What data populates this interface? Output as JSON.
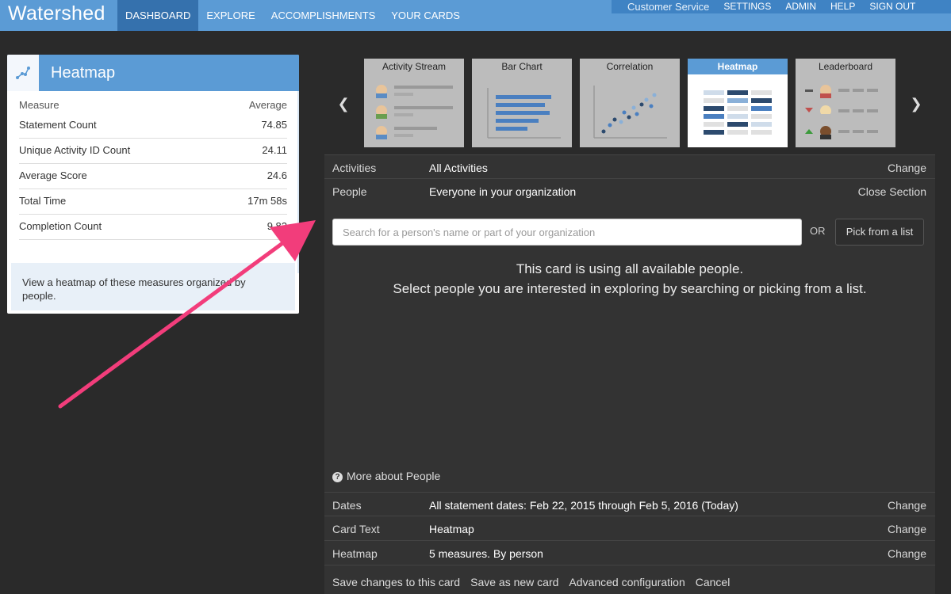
{
  "app": {
    "logo": "Watershed",
    "nav": [
      "DASHBOARD",
      "EXPLORE",
      "ACCOMPLISHMENTS",
      "YOUR CARDS"
    ],
    "utility": [
      "Customer Service",
      "SETTINGS",
      "ADMIN",
      "HELP",
      "SIGN OUT"
    ],
    "accent": "#5b9bd5"
  },
  "card": {
    "title": "Heatmap",
    "icon": "scatter-trend-icon",
    "header_measure": "Measure",
    "header_average": "Average",
    "rows": [
      {
        "label": "Statement Count",
        "value": "74.85"
      },
      {
        "label": "Unique Activity ID Count",
        "value": "24.11"
      },
      {
        "label": "Average Score",
        "value": "24.6"
      },
      {
        "label": "Total Time",
        "value": "17m 58s"
      },
      {
        "label": "Completion Count",
        "value": "9.82"
      }
    ],
    "description": "View a heatmap of these measures organized by people."
  },
  "editor": {
    "card_types": [
      "Activity Stream",
      "Bar Chart",
      "Correlation",
      "Heatmap",
      "Leaderboard"
    ],
    "selected_type": "Heatmap",
    "sections": {
      "activities": {
        "label": "Activities",
        "value": "All Activities",
        "action": "Change"
      },
      "people": {
        "label": "People",
        "value": "Everyone in your organization",
        "action": "Close Section"
      },
      "dates": {
        "label": "Dates",
        "value": "All statement dates: Feb 22, 2015 through Feb 5, 2016 (Today)",
        "action": "Change"
      },
      "card_text": {
        "label": "Card Text",
        "value": "Heatmap",
        "action": "Change"
      },
      "heatmap": {
        "label": "Heatmap",
        "value": "5 measures. By person",
        "action": "Change"
      }
    },
    "search_placeholder": "Search for a person's name or part of your organization",
    "or_label": "OR",
    "pick_button": "Pick from a list",
    "message_line1": "This card is using all available people.",
    "message_line2": "Select people you are interested in exploring by searching or picking from a list.",
    "more_link": "More about People",
    "bottom_actions": [
      "Save changes to this card",
      "Save as new card",
      "Advanced configuration",
      "Cancel"
    ]
  }
}
